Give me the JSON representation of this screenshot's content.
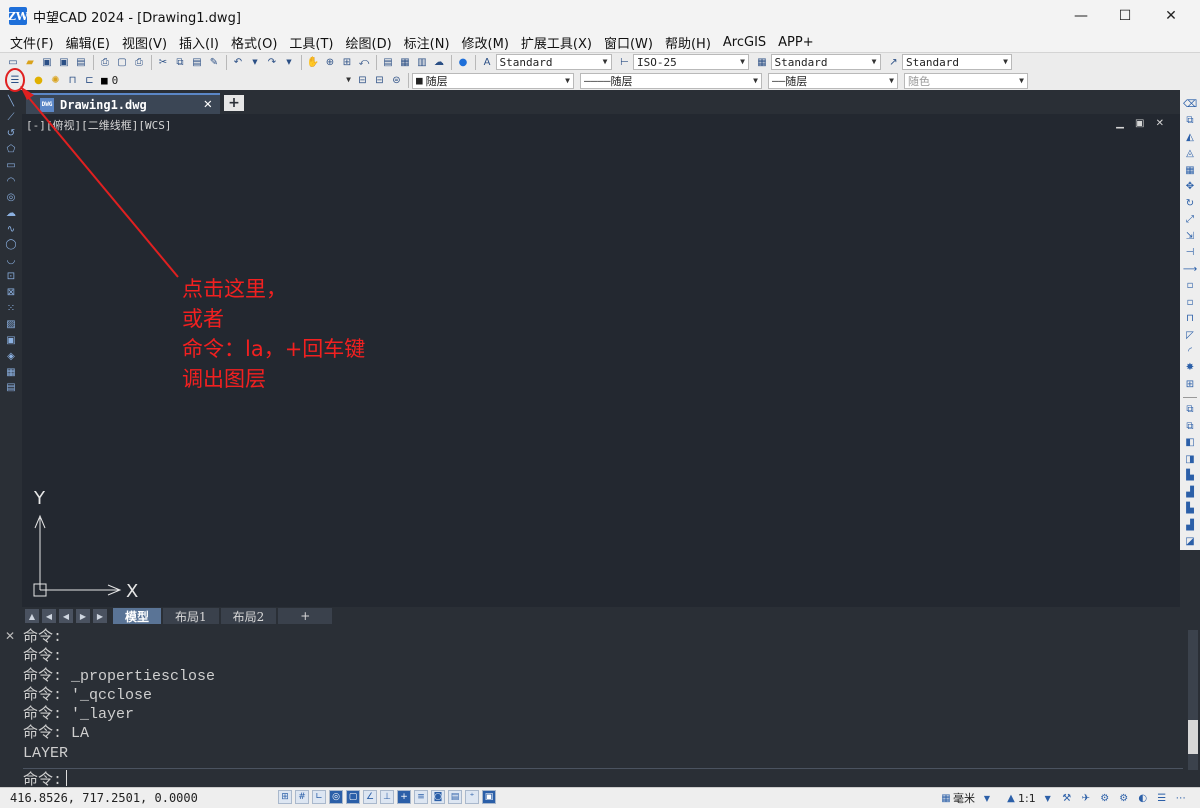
{
  "window": {
    "app_logo": "ZW",
    "title": "中望CAD 2024 - [Drawing1.dwg]",
    "minimize": "—",
    "maximize": "☐",
    "close": "✕"
  },
  "menu": [
    "文件(F)",
    "编辑(E)",
    "视图(V)",
    "插入(I)",
    "格式(O)",
    "工具(T)",
    "绘图(D)",
    "标注(N)",
    "修改(M)",
    "扩展工具(X)",
    "窗口(W)",
    "帮助(H)",
    "ArcGIS",
    "APP+"
  ],
  "toolbar1": {
    "text_style": "Standard",
    "dim_style": "ISO-25",
    "table_style": "Standard",
    "multileader_style": "Standard"
  },
  "toolbar2": {
    "layer_name": "0",
    "color": "随层",
    "linetype": "随层",
    "lineweight": "随层",
    "plot_style": "随色",
    "linetype_prefix": "————",
    "lineweight_prefix": "——"
  },
  "document": {
    "tab_label": "Drawing1.dwg",
    "tab_icon_text": "DWG",
    "close": "✕",
    "new_tab": "+"
  },
  "viewport": {
    "label": "[-][俯视][二维线框][WCS]",
    "controls": "▁ ▣ ✕"
  },
  "ucs": {
    "y_label": "Y",
    "x_label": "X"
  },
  "annotation": {
    "lines": [
      "点击这里，",
      "或者",
      "命令：la，+回车键",
      "调出图层"
    ],
    "color": "#f22020"
  },
  "layout_tabs": [
    "模型",
    "布局1",
    "布局2",
    "+"
  ],
  "command": {
    "history": [
      "命令:",
      "命令:",
      "命令: _propertiesclose",
      "命令: '_qcclose",
      "命令: '_layer",
      "命令: LA",
      "LAYER"
    ],
    "prompt": "命令:",
    "close": "✕"
  },
  "status": {
    "coords": "416.8526, 717.2501, 0.0000",
    "units": "毫米",
    "scale": "1:1"
  }
}
